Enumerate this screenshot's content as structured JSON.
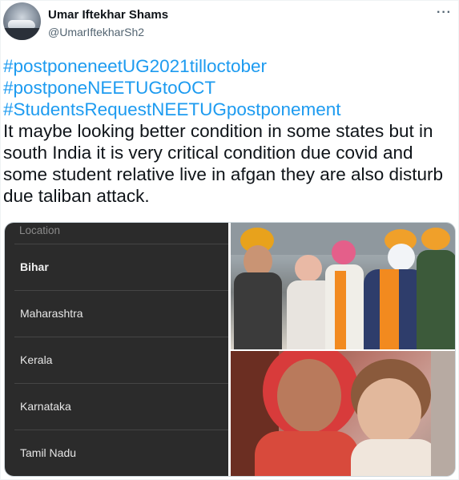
{
  "user": {
    "name": "Umar Iftekhar Shams",
    "handle": "@UmarIftekharSh2"
  },
  "icons": {
    "more": "more-options-icon"
  },
  "tweet": {
    "hashtags": [
      "#postponeneetUG2021tilloctober",
      "#postponeNEETUGtoOCT",
      "#StudentsRequestNEETUGpostponement"
    ],
    "body": "It maybe looking better condition in some states but in south India it is very critical condition due covid and some student relative live in afgan they are also disturb due taliban attack."
  },
  "media": {
    "location_list": {
      "header": "Location",
      "items": [
        "Bihar",
        "Maharashtra",
        "Kerala",
        "Karnataka",
        "Tamil Nadu"
      ]
    }
  },
  "colors": {
    "link": "#1d9bf0",
    "text": "#0f1419",
    "secondary": "#536471",
    "list_bg": "#2b2b2b"
  }
}
